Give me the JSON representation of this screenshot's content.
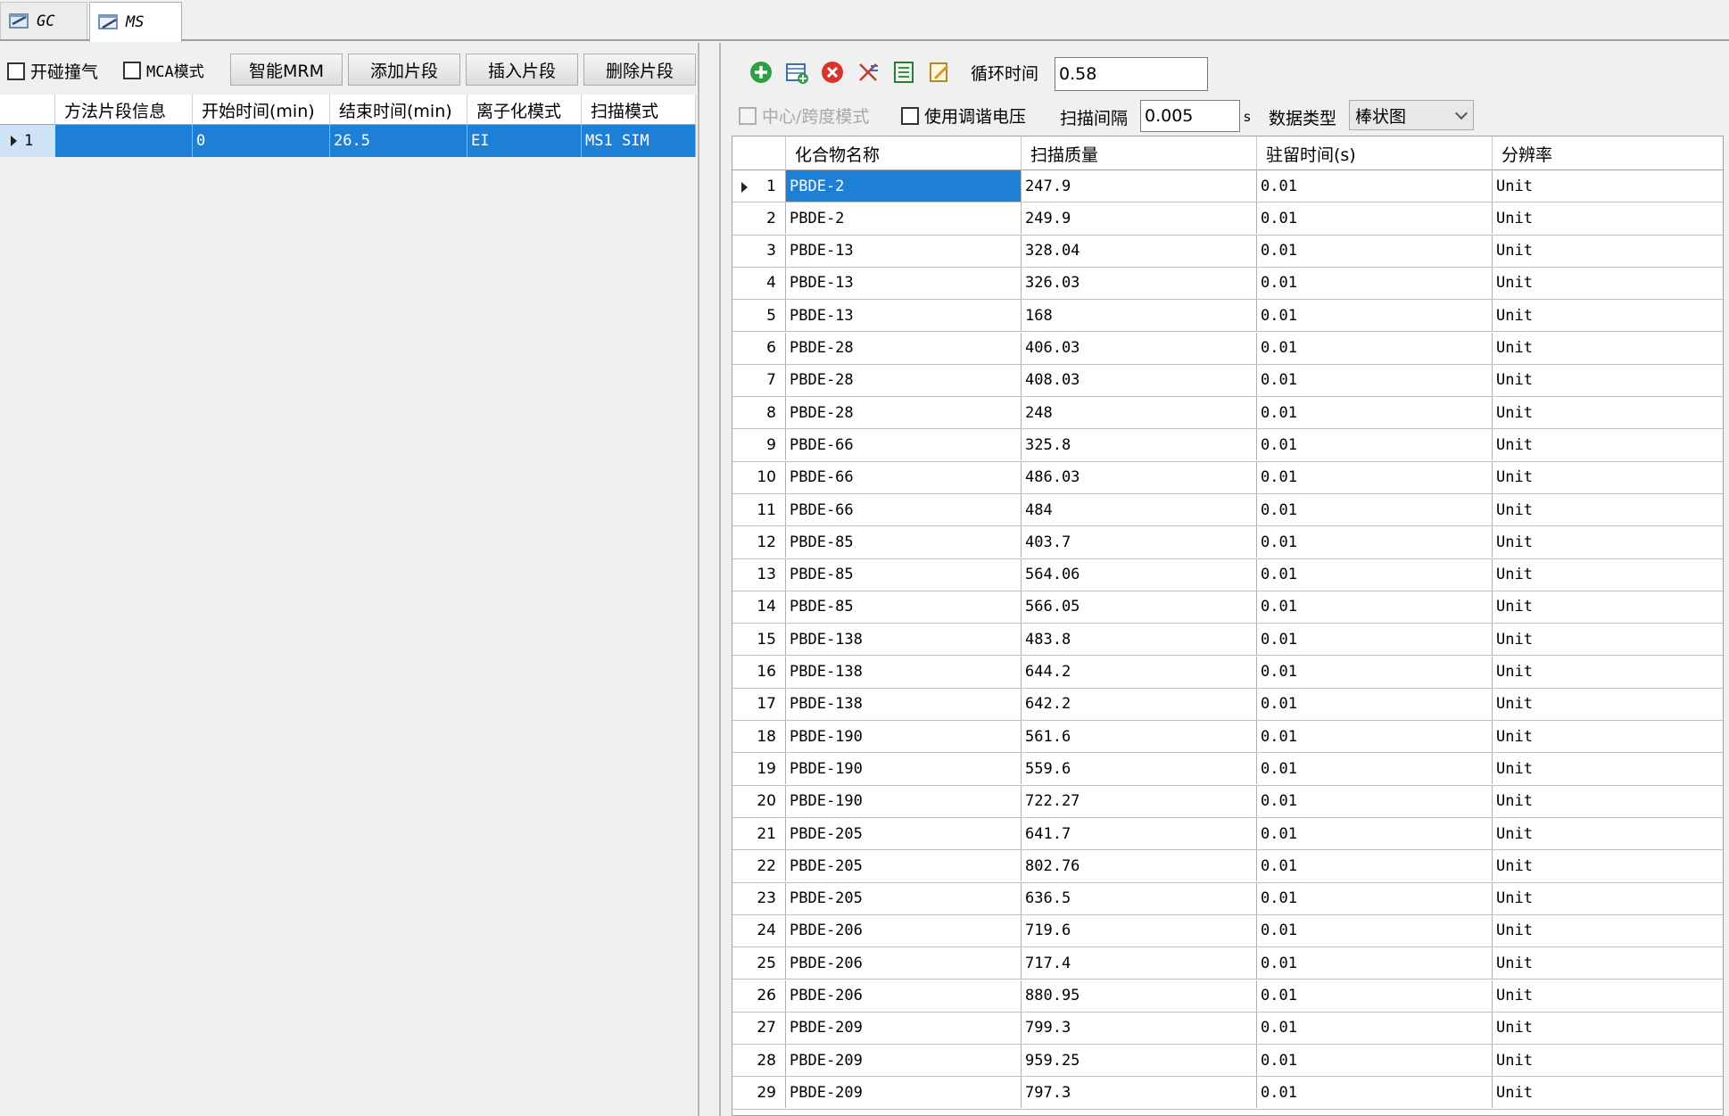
{
  "tabs": [
    {
      "label": "GC",
      "icon": "gc-tab-icon"
    },
    {
      "label": "MS",
      "icon": "ms-tab-icon"
    }
  ],
  "left": {
    "checkboxes": {
      "collision_gas": "开碰撞气",
      "mca_mode": "MCA模式"
    },
    "buttons": {
      "smart_mrm": "智能MRM",
      "add_segment": "添加片段",
      "insert_segment": "插入片段",
      "delete_segment": "删除片段"
    },
    "columns": [
      "方法片段信息",
      "开始时间(min)",
      "结束时间(min)",
      "离子化模式",
      "扫描模式"
    ],
    "rows": [
      {
        "index": "1",
        "info": "",
        "start": "0",
        "end": "26.5",
        "ion_mode": "EI",
        "scan_mode": "MS1 SIM"
      }
    ]
  },
  "right": {
    "toolbar": {
      "cycle_time_label": "循环时间",
      "cycle_time_value": "0.58",
      "center_span_label": "中心/跨度模式",
      "use_tune_voltage_label": "使用调谐电压",
      "scan_interval_label": "扫描间隔",
      "scan_interval_value": "0.005",
      "scan_interval_unit": "s",
      "data_type_label": "数据类型",
      "data_type_value": "棒状图"
    },
    "columns": [
      "化合物名称",
      "扫描质量",
      "驻留时间(s)",
      "分辨率"
    ],
    "rows": [
      {
        "n": "1",
        "name": "PBDE-2",
        "mass": "247.9",
        "dwell": "0.01",
        "res": "Unit"
      },
      {
        "n": "2",
        "name": "PBDE-2",
        "mass": "249.9",
        "dwell": "0.01",
        "res": "Unit"
      },
      {
        "n": "3",
        "name": "PBDE-13",
        "mass": "328.04",
        "dwell": "0.01",
        "res": "Unit"
      },
      {
        "n": "4",
        "name": "PBDE-13",
        "mass": "326.03",
        "dwell": "0.01",
        "res": "Unit"
      },
      {
        "n": "5",
        "name": "PBDE-13",
        "mass": "168",
        "dwell": "0.01",
        "res": "Unit"
      },
      {
        "n": "6",
        "name": "PBDE-28",
        "mass": "406.03",
        "dwell": "0.01",
        "res": "Unit"
      },
      {
        "n": "7",
        "name": "PBDE-28",
        "mass": "408.03",
        "dwell": "0.01",
        "res": "Unit"
      },
      {
        "n": "8",
        "name": "PBDE-28",
        "mass": "248",
        "dwell": "0.01",
        "res": "Unit"
      },
      {
        "n": "9",
        "name": "PBDE-66",
        "mass": "325.8",
        "dwell": "0.01",
        "res": "Unit"
      },
      {
        "n": "10",
        "name": "PBDE-66",
        "mass": "486.03",
        "dwell": "0.01",
        "res": "Unit"
      },
      {
        "n": "11",
        "name": "PBDE-66",
        "mass": "484",
        "dwell": "0.01",
        "res": "Unit"
      },
      {
        "n": "12",
        "name": "PBDE-85",
        "mass": "403.7",
        "dwell": "0.01",
        "res": "Unit"
      },
      {
        "n": "13",
        "name": "PBDE-85",
        "mass": "564.06",
        "dwell": "0.01",
        "res": "Unit"
      },
      {
        "n": "14",
        "name": "PBDE-85",
        "mass": "566.05",
        "dwell": "0.01",
        "res": "Unit"
      },
      {
        "n": "15",
        "name": "PBDE-138",
        "mass": "483.8",
        "dwell": "0.01",
        "res": "Unit"
      },
      {
        "n": "16",
        "name": "PBDE-138",
        "mass": "644.2",
        "dwell": "0.01",
        "res": "Unit"
      },
      {
        "n": "17",
        "name": "PBDE-138",
        "mass": "642.2",
        "dwell": "0.01",
        "res": "Unit"
      },
      {
        "n": "18",
        "name": "PBDE-190",
        "mass": "561.6",
        "dwell": "0.01",
        "res": "Unit"
      },
      {
        "n": "19",
        "name": "PBDE-190",
        "mass": "559.6",
        "dwell": "0.01",
        "res": "Unit"
      },
      {
        "n": "20",
        "name": "PBDE-190",
        "mass": "722.27",
        "dwell": "0.01",
        "res": "Unit"
      },
      {
        "n": "21",
        "name": "PBDE-205",
        "mass": "641.7",
        "dwell": "0.01",
        "res": "Unit"
      },
      {
        "n": "22",
        "name": "PBDE-205",
        "mass": "802.76",
        "dwell": "0.01",
        "res": "Unit"
      },
      {
        "n": "23",
        "name": "PBDE-205",
        "mass": "636.5",
        "dwell": "0.01",
        "res": "Unit"
      },
      {
        "n": "24",
        "name": "PBDE-206",
        "mass": "719.6",
        "dwell": "0.01",
        "res": "Unit"
      },
      {
        "n": "25",
        "name": "PBDE-206",
        "mass": "717.4",
        "dwell": "0.01",
        "res": "Unit"
      },
      {
        "n": "26",
        "name": "PBDE-206",
        "mass": "880.95",
        "dwell": "0.01",
        "res": "Unit"
      },
      {
        "n": "27",
        "name": "PBDE-209",
        "mass": "799.3",
        "dwell": "0.01",
        "res": "Unit"
      },
      {
        "n": "28",
        "name": "PBDE-209",
        "mass": "959.25",
        "dwell": "0.01",
        "res": "Unit"
      },
      {
        "n": "29",
        "name": "PBDE-209",
        "mass": "797.3",
        "dwell": "0.01",
        "res": "Unit"
      }
    ]
  },
  "colors": {
    "selection": "#1e7fd6",
    "add_icon": "#2ea043",
    "delete_icon": "#d9342b"
  }
}
